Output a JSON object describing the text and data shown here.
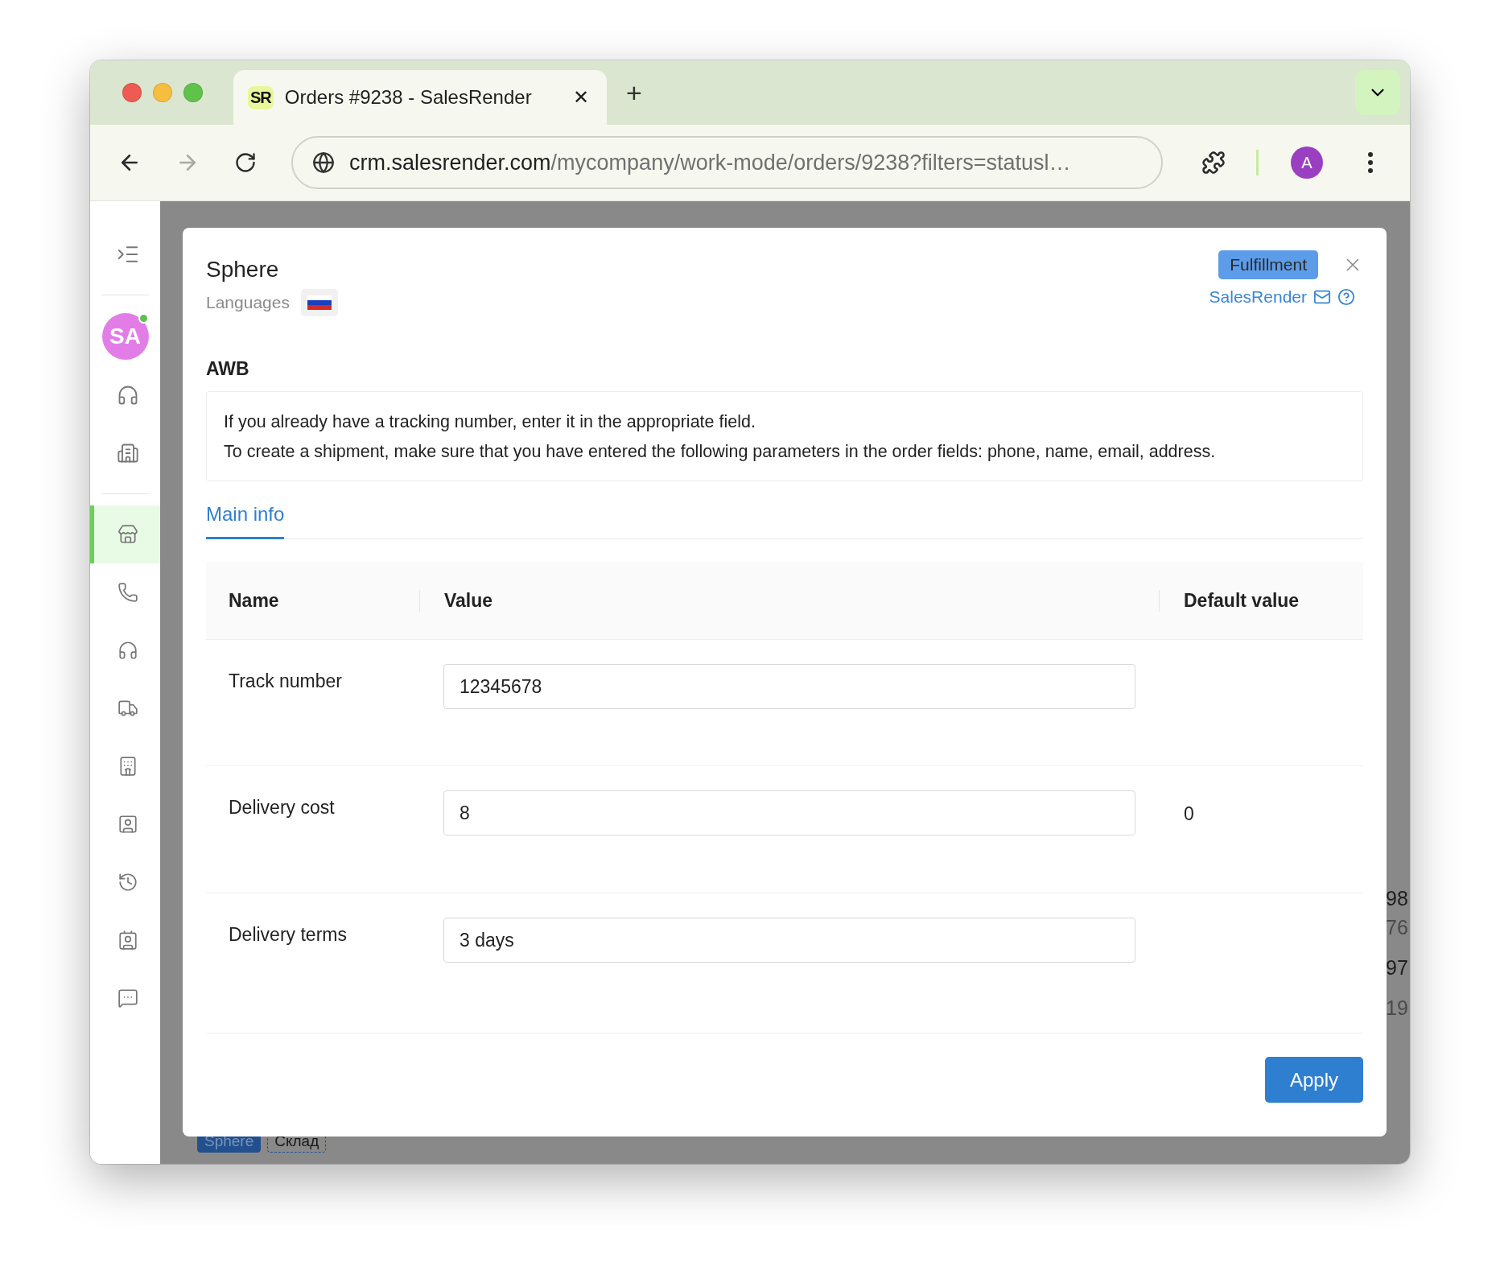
{
  "browser": {
    "tab": {
      "favicon": "SR",
      "title": "Orders #9238 - SalesRender",
      "close": "✕"
    },
    "new_tab": "+",
    "forward_disabled": true,
    "address": {
      "domain": "crm.salesrender.com",
      "path": "/mycompany/work-mode/orders/9238?filters=statusl…"
    },
    "profile": "A"
  },
  "sidebar": {
    "avatar": {
      "initials": "SA",
      "online": true
    },
    "top_items": [
      {
        "selected": false
      },
      {
        "selected": false
      }
    ],
    "items": [
      {
        "selected": true
      },
      {
        "selected": false
      },
      {
        "selected": false
      },
      {
        "selected": false
      },
      {
        "selected": false
      },
      {
        "selected": false
      },
      {
        "selected": false
      },
      {
        "selected": false
      },
      {
        "selected": false
      }
    ]
  },
  "background": {
    "side_values": [
      "98",
      "76",
      "97",
      "19"
    ],
    "tags": [
      {
        "label": "Sphere",
        "selected": true
      },
      {
        "label": "Склад",
        "selected": false
      }
    ]
  },
  "modal": {
    "title": "Sphere",
    "languages_label": "Languages",
    "badge": "Fulfillment",
    "link": "SalesRender",
    "section": "AWB",
    "info": [
      "If you already have a tracking number, enter it in the appropriate field.",
      "To create a shipment, make sure that you have entered the following parameters in the order fields: phone, name, email, address."
    ],
    "tabs": [
      {
        "label": "Main info",
        "selected": true
      }
    ],
    "table": {
      "columns": [
        "Name",
        "Value",
        "Default value"
      ],
      "rows": [
        {
          "name": "Track number",
          "value": "12345678"
        },
        {
          "name": "Delivery cost",
          "value": "8",
          "default": "0"
        },
        {
          "name": "Delivery terms",
          "value": "3 days"
        }
      ]
    },
    "apply": "Apply"
  }
}
